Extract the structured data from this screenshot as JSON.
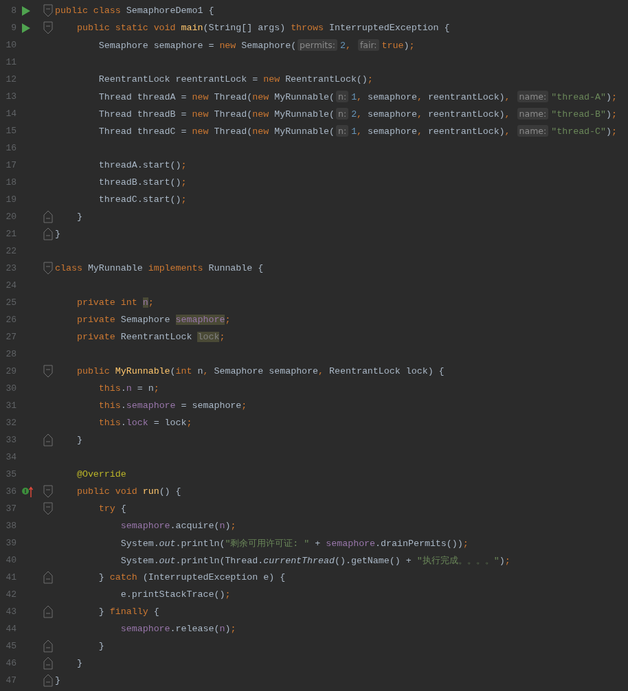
{
  "editor": {
    "lines": [
      {
        "number": "8",
        "runnable": true,
        "fold_start": true,
        "tokens": [
          {
            "text": "public class ",
            "kind": "keyword"
          },
          {
            "text": "SemaphoreDemo1 {",
            "kind": "plain"
          }
        ]
      },
      {
        "number": "9",
        "runnable": true,
        "fold_start": true,
        "tokens": [
          {
            "text": "    public static void ",
            "kind": "keyword"
          },
          {
            "text": "main",
            "kind": "method"
          },
          {
            "text": "(String[] args) ",
            "kind": "plain"
          },
          {
            "text": "throws ",
            "kind": "keyword"
          },
          {
            "text": "InterruptedException {",
            "kind": "plain"
          }
        ]
      },
      {
        "number": "10",
        "tokens": [
          {
            "text": "        Semaphore semaphore = ",
            "kind": "plain"
          },
          {
            "text": "new ",
            "kind": "keyword"
          },
          {
            "text": "Semaphore(",
            "kind": "plain"
          },
          {
            "text": "permits:",
            "kind": "hint"
          },
          {
            "text": "2",
            "kind": "number"
          },
          {
            "text": ", ",
            "kind": "punct"
          },
          {
            "text": "fair:",
            "kind": "hint"
          },
          {
            "text": "true",
            "kind": "keyword"
          },
          {
            "text": ")",
            "kind": "plain"
          },
          {
            "text": ";",
            "kind": "punct"
          }
        ]
      },
      {
        "number": "11"
      },
      {
        "number": "12",
        "tokens": [
          {
            "text": "        ReentrantLock reentrantLock = ",
            "kind": "plain"
          },
          {
            "text": "new ",
            "kind": "keyword"
          },
          {
            "text": "ReentrantLock()",
            "kind": "plain"
          },
          {
            "text": ";",
            "kind": "punct"
          }
        ]
      },
      {
        "number": "13",
        "tokens": [
          {
            "text": "        Thread threadA = ",
            "kind": "plain"
          },
          {
            "text": "new ",
            "kind": "keyword"
          },
          {
            "text": "Thread(",
            "kind": "plain"
          },
          {
            "text": "new ",
            "kind": "keyword"
          },
          {
            "text": "MyRunnable(",
            "kind": "plain"
          },
          {
            "text": "n:",
            "kind": "hint"
          },
          {
            "text": "1",
            "kind": "number"
          },
          {
            "text": ", ",
            "kind": "punct"
          },
          {
            "text": "semaphore",
            "kind": "plain"
          },
          {
            "text": ", ",
            "kind": "punct"
          },
          {
            "text": "reentrantLock)",
            "kind": "plain"
          },
          {
            "text": ", ",
            "kind": "punct"
          },
          {
            "text": "name:",
            "kind": "hint"
          },
          {
            "text": "\"thread-A\"",
            "kind": "string"
          },
          {
            "text": ")",
            "kind": "plain"
          },
          {
            "text": ";",
            "kind": "punct"
          }
        ]
      },
      {
        "number": "14",
        "tokens": [
          {
            "text": "        Thread threadB = ",
            "kind": "plain"
          },
          {
            "text": "new ",
            "kind": "keyword"
          },
          {
            "text": "Thread(",
            "kind": "plain"
          },
          {
            "text": "new ",
            "kind": "keyword"
          },
          {
            "text": "MyRunnable(",
            "kind": "plain"
          },
          {
            "text": "n:",
            "kind": "hint"
          },
          {
            "text": "2",
            "kind": "number"
          },
          {
            "text": ", ",
            "kind": "punct"
          },
          {
            "text": "semaphore",
            "kind": "plain"
          },
          {
            "text": ", ",
            "kind": "punct"
          },
          {
            "text": "reentrantLock)",
            "kind": "plain"
          },
          {
            "text": ", ",
            "kind": "punct"
          },
          {
            "text": "name:",
            "kind": "hint"
          },
          {
            "text": "\"thread-B\"",
            "kind": "string"
          },
          {
            "text": ")",
            "kind": "plain"
          },
          {
            "text": ";",
            "kind": "punct"
          }
        ]
      },
      {
        "number": "15",
        "tokens": [
          {
            "text": "        Thread threadC = ",
            "kind": "plain"
          },
          {
            "text": "new ",
            "kind": "keyword"
          },
          {
            "text": "Thread(",
            "kind": "plain"
          },
          {
            "text": "new ",
            "kind": "keyword"
          },
          {
            "text": "MyRunnable(",
            "kind": "plain"
          },
          {
            "text": "n:",
            "kind": "hint"
          },
          {
            "text": "1",
            "kind": "number"
          },
          {
            "text": ", ",
            "kind": "punct"
          },
          {
            "text": "semaphore",
            "kind": "plain"
          },
          {
            "text": ", ",
            "kind": "punct"
          },
          {
            "text": "reentrantLock)",
            "kind": "plain"
          },
          {
            "text": ", ",
            "kind": "punct"
          },
          {
            "text": "name:",
            "kind": "hint"
          },
          {
            "text": "\"thread-C\"",
            "kind": "string"
          },
          {
            "text": ")",
            "kind": "plain"
          },
          {
            "text": ";",
            "kind": "punct"
          }
        ]
      },
      {
        "number": "16"
      },
      {
        "number": "17",
        "tokens": [
          {
            "text": "        threadA.start()",
            "kind": "plain"
          },
          {
            "text": ";",
            "kind": "punct"
          }
        ]
      },
      {
        "number": "18",
        "tokens": [
          {
            "text": "        threadB.start()",
            "kind": "plain"
          },
          {
            "text": ";",
            "kind": "punct"
          }
        ]
      },
      {
        "number": "19",
        "tokens": [
          {
            "text": "        threadC.start()",
            "kind": "plain"
          },
          {
            "text": ";",
            "kind": "punct"
          }
        ]
      },
      {
        "number": "20",
        "fold_end": true,
        "tokens": [
          {
            "text": "    }",
            "kind": "plain"
          }
        ]
      },
      {
        "number": "21",
        "fold_end": true,
        "tokens": [
          {
            "text": "}",
            "kind": "plain"
          }
        ]
      },
      {
        "number": "22"
      },
      {
        "number": "23",
        "fold_start": true,
        "tokens": [
          {
            "text": "class ",
            "kind": "keyword"
          },
          {
            "text": "MyRunnable ",
            "kind": "plain"
          },
          {
            "text": "implements ",
            "kind": "keyword"
          },
          {
            "text": "Runnable {",
            "kind": "plain"
          }
        ]
      },
      {
        "number": "24"
      },
      {
        "number": "25",
        "tokens": [
          {
            "text": "    private int ",
            "kind": "keyword"
          },
          {
            "text": "n",
            "kind": "field-highlight"
          },
          {
            "text": ";",
            "kind": "punct"
          }
        ]
      },
      {
        "number": "26",
        "tokens": [
          {
            "text": "    private ",
            "kind": "keyword"
          },
          {
            "text": "Semaphore ",
            "kind": "plain"
          },
          {
            "text": "semaphore",
            "kind": "field-highlight"
          },
          {
            "text": ";",
            "kind": "punct"
          }
        ]
      },
      {
        "number": "27",
        "tokens": [
          {
            "text": "    private ",
            "kind": "keyword"
          },
          {
            "text": "ReentrantLock ",
            "kind": "plain"
          },
          {
            "text": "lock",
            "kind": "unused-highlight"
          },
          {
            "text": ";",
            "kind": "punct"
          }
        ]
      },
      {
        "number": "28"
      },
      {
        "number": "29",
        "fold_start": true,
        "tokens": [
          {
            "text": "    public ",
            "kind": "keyword"
          },
          {
            "text": "MyRunnable",
            "kind": "method"
          },
          {
            "text": "(",
            "kind": "plain"
          },
          {
            "text": "int ",
            "kind": "keyword"
          },
          {
            "text": "n",
            "kind": "plain"
          },
          {
            "text": ", ",
            "kind": "punct"
          },
          {
            "text": "Semaphore semaphore",
            "kind": "plain"
          },
          {
            "text": ", ",
            "kind": "punct"
          },
          {
            "text": "ReentrantLock lock) {",
            "kind": "plain"
          }
        ]
      },
      {
        "number": "30",
        "tokens": [
          {
            "text": "        this",
            "kind": "keyword"
          },
          {
            "text": ".",
            "kind": "plain"
          },
          {
            "text": "n",
            "kind": "field"
          },
          {
            "text": " = n",
            "kind": "plain"
          },
          {
            "text": ";",
            "kind": "punct"
          }
        ]
      },
      {
        "number": "31",
        "tokens": [
          {
            "text": "        this",
            "kind": "keyword"
          },
          {
            "text": ".",
            "kind": "plain"
          },
          {
            "text": "semaphore",
            "kind": "field"
          },
          {
            "text": " = semaphore",
            "kind": "plain"
          },
          {
            "text": ";",
            "kind": "punct"
          }
        ]
      },
      {
        "number": "32",
        "tokens": [
          {
            "text": "        this",
            "kind": "keyword"
          },
          {
            "text": ".",
            "kind": "plain"
          },
          {
            "text": "lock",
            "kind": "field"
          },
          {
            "text": " = lock",
            "kind": "plain"
          },
          {
            "text": ";",
            "kind": "punct"
          }
        ]
      },
      {
        "number": "33",
        "fold_end": true,
        "tokens": [
          {
            "text": "    }",
            "kind": "plain"
          }
        ]
      },
      {
        "number": "34"
      },
      {
        "number": "35",
        "tokens": [
          {
            "text": "    @Override",
            "kind": "annotation"
          }
        ]
      },
      {
        "number": "36",
        "overrides": true,
        "fold_start": true,
        "tokens": [
          {
            "text": "    public void ",
            "kind": "keyword"
          },
          {
            "text": "run",
            "kind": "method"
          },
          {
            "text": "() {",
            "kind": "plain"
          }
        ]
      },
      {
        "number": "37",
        "fold_start": true,
        "tokens": [
          {
            "text": "        try ",
            "kind": "keyword"
          },
          {
            "text": "{",
            "kind": "plain"
          }
        ]
      },
      {
        "number": "38",
        "tokens": [
          {
            "text": "            semaphore",
            "kind": "field"
          },
          {
            "text": ".acquire(",
            "kind": "plain"
          },
          {
            "text": "n",
            "kind": "field"
          },
          {
            "text": ")",
            "kind": "plain"
          },
          {
            "text": ";",
            "kind": "punct"
          }
        ]
      },
      {
        "number": "39",
        "tokens": [
          {
            "text": "            System.",
            "kind": "plain"
          },
          {
            "text": "out",
            "kind": "static"
          },
          {
            "text": ".println(",
            "kind": "plain"
          },
          {
            "text": "\"剩余可用许可证: \"",
            "kind": "string"
          },
          {
            "text": " + ",
            "kind": "plain"
          },
          {
            "text": "semaphore",
            "kind": "field"
          },
          {
            "text": ".drainPermits())",
            "kind": "plain"
          },
          {
            "text": ";",
            "kind": "punct"
          }
        ]
      },
      {
        "number": "40",
        "tokens": [
          {
            "text": "            System.",
            "kind": "plain"
          },
          {
            "text": "out",
            "kind": "static"
          },
          {
            "text": ".println(Thread.",
            "kind": "plain"
          },
          {
            "text": "currentThread",
            "kind": "static"
          },
          {
            "text": "().getName() + ",
            "kind": "plain"
          },
          {
            "text": "\"执行完成。。。。\"",
            "kind": "string"
          },
          {
            "text": ")",
            "kind": "plain"
          },
          {
            "text": ";",
            "kind": "punct"
          }
        ]
      },
      {
        "number": "41",
        "fold_end": true,
        "tokens": [
          {
            "text": "        } ",
            "kind": "plain"
          },
          {
            "text": "catch ",
            "kind": "keyword"
          },
          {
            "text": "(InterruptedException e) {",
            "kind": "plain"
          }
        ]
      },
      {
        "number": "42",
        "tokens": [
          {
            "text": "            e.printStackTrace()",
            "kind": "plain"
          },
          {
            "text": ";",
            "kind": "punct"
          }
        ]
      },
      {
        "number": "43",
        "fold_end": true,
        "tokens": [
          {
            "text": "        } ",
            "kind": "plain"
          },
          {
            "text": "finally ",
            "kind": "keyword"
          },
          {
            "text": "{",
            "kind": "plain"
          }
        ]
      },
      {
        "number": "44",
        "tokens": [
          {
            "text": "            semaphore",
            "kind": "field"
          },
          {
            "text": ".release(",
            "kind": "plain"
          },
          {
            "text": "n",
            "kind": "field"
          },
          {
            "text": ")",
            "kind": "plain"
          },
          {
            "text": ";",
            "kind": "punct"
          }
        ]
      },
      {
        "number": "45",
        "fold_end": true,
        "tokens": [
          {
            "text": "        }",
            "kind": "plain"
          }
        ]
      },
      {
        "number": "46",
        "fold_end": true,
        "tokens": [
          {
            "text": "    }",
            "kind": "plain"
          }
        ]
      },
      {
        "number": "47",
        "fold_end": true,
        "tokens": [
          {
            "text": "}",
            "kind": "plain"
          }
        ]
      }
    ]
  }
}
